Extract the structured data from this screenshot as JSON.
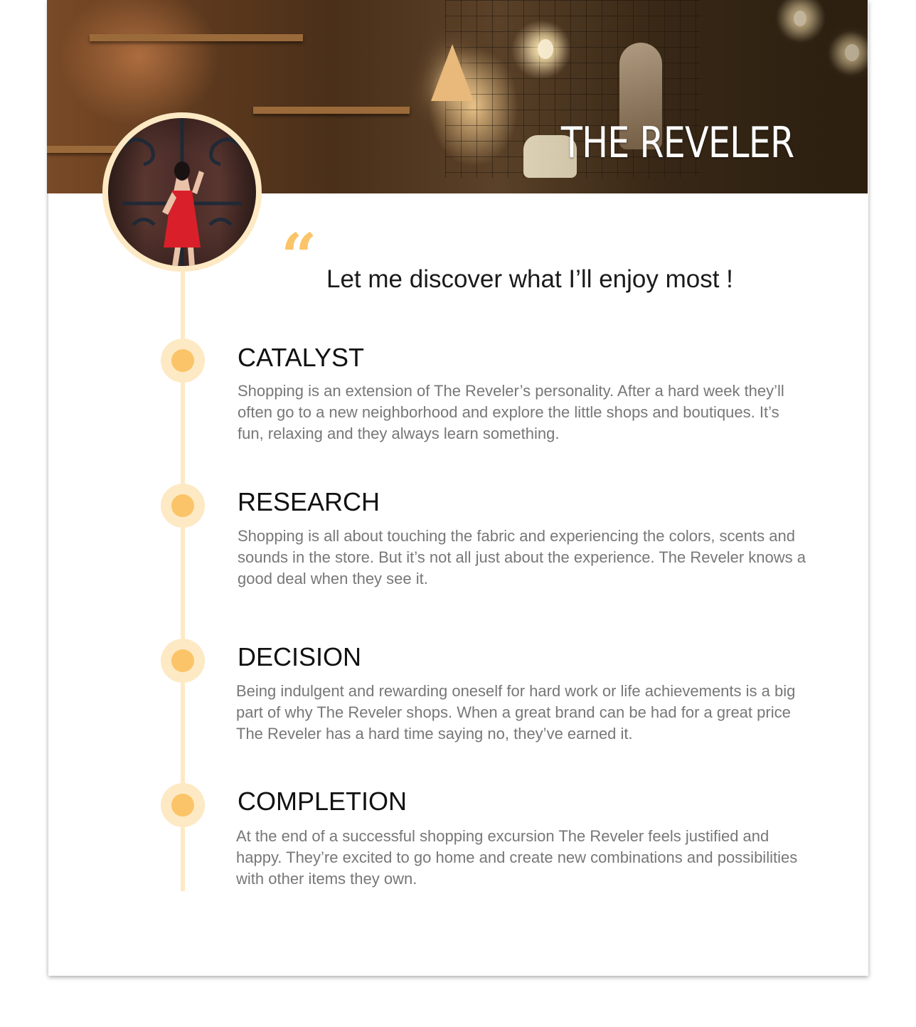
{
  "header": {
    "title": "THE REVELER"
  },
  "quote": {
    "mark": "“",
    "text": "Let me discover what I’ll enjoy most !"
  },
  "steps": [
    {
      "title": "CATALYST",
      "body": "Shopping is an extension of The Reveler’s personality. After a hard week they’ll often go to a new neighborhood and explore the little shops and boutiques. It’s fun, relaxing and they always learn something."
    },
    {
      "title": "RESEARCH",
      "body": "Shopping is all about touching the fabric and experiencing the colors, scents and sounds in the store. But it’s not all just about the experience. The Reveler knows a good deal when they see it."
    },
    {
      "title": "DECISION",
      "body": "Being indulgent and rewarding oneself for hard work or life achievements is a big part of why The Reveler shops. When a great brand can be had for a great price The Reveler has a hard time saying no, they’ve earned it."
    },
    {
      "title": "COMPLETION",
      "body": "At the end of a successful shopping excursion The Reveler feels justified and happy. They’re excited to go home and create new combinations and possibilities with other items they own."
    }
  ],
  "colors": {
    "accent": "#fbc468",
    "accent_light": "#fde9c4",
    "heading": "#111111",
    "body_text": "#777777"
  }
}
